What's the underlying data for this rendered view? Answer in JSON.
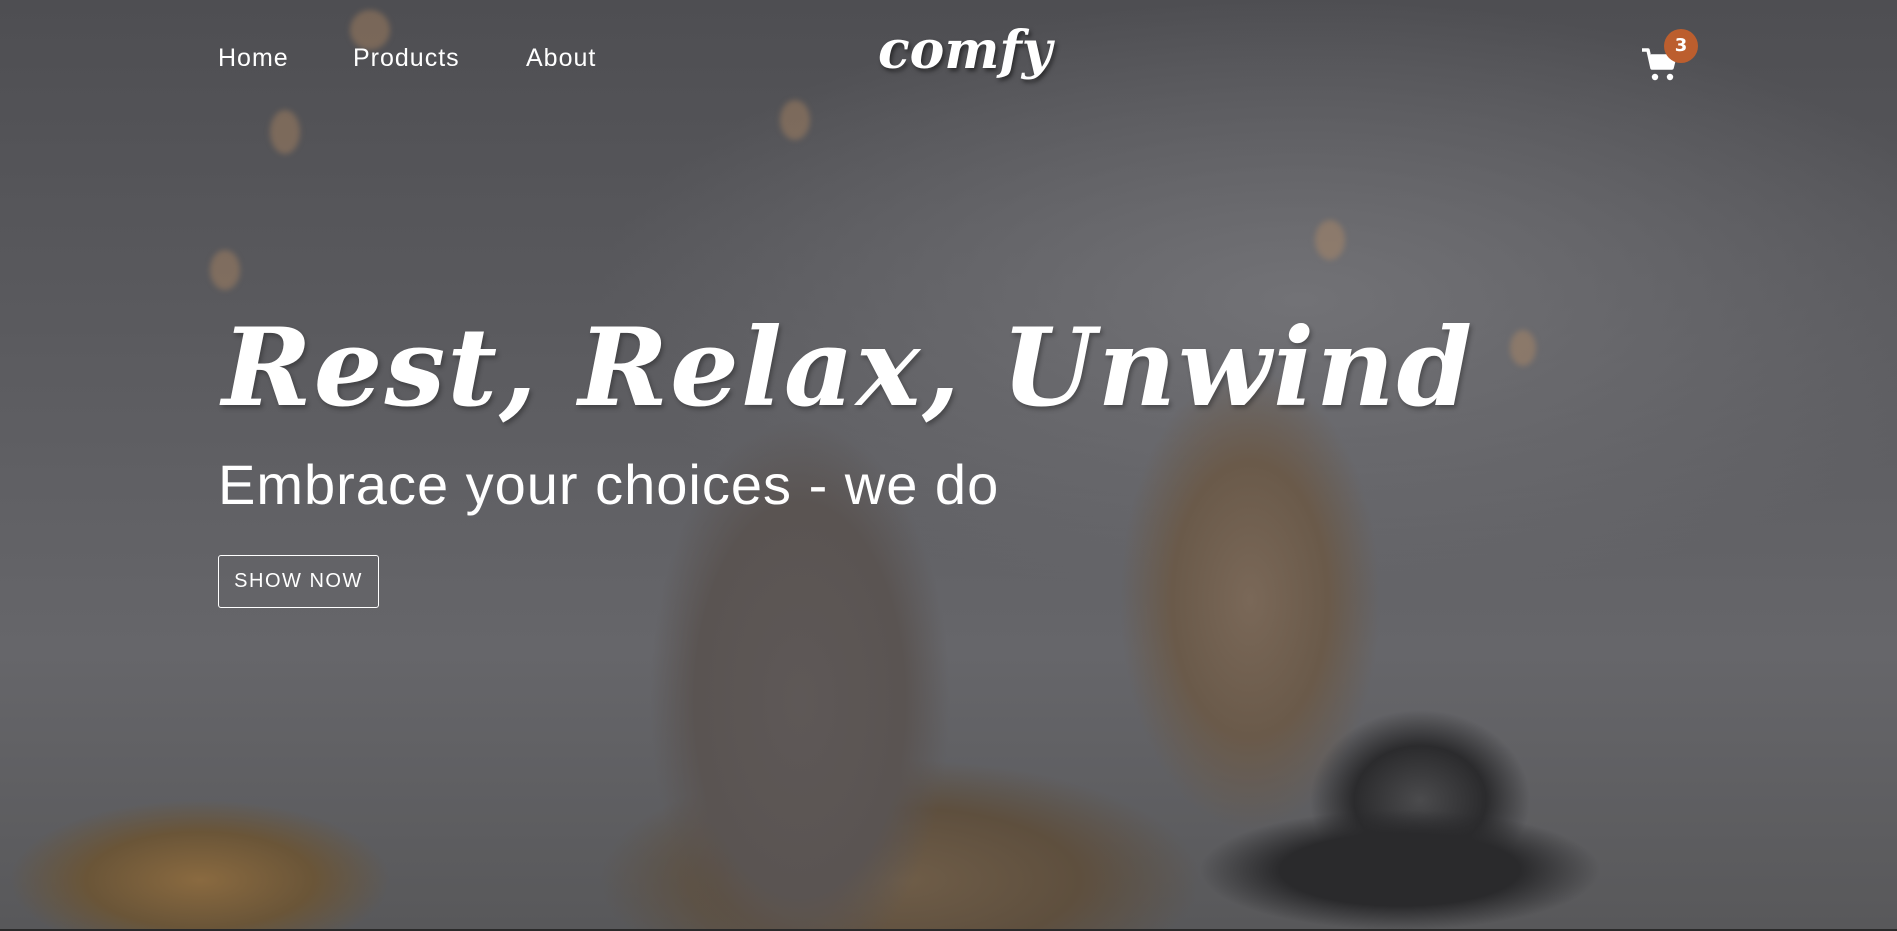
{
  "nav": {
    "links": [
      "Home",
      "Products",
      "About"
    ]
  },
  "brand": {
    "logo": "comfy"
  },
  "cart": {
    "icon": "shopping-cart-icon",
    "count": "3",
    "badge_color": "#bc5e2e"
  },
  "hero": {
    "title": "Rest, Relax, Unwind",
    "subtitle": "Embrace your choices - we do",
    "button": "show now"
  }
}
